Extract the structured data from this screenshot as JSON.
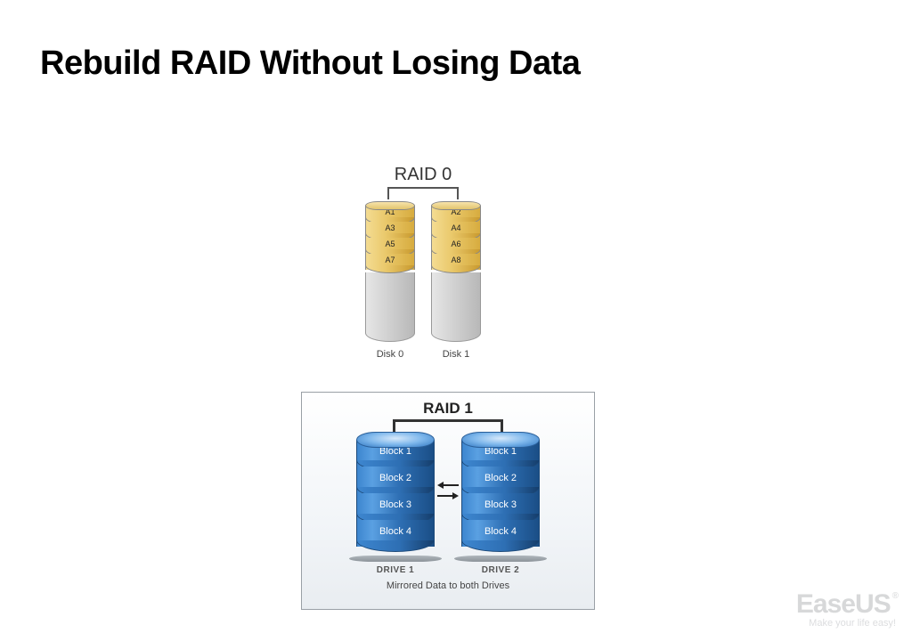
{
  "title": "Rebuild RAID Without Losing Data",
  "raid0": {
    "heading": "RAID 0",
    "disks": [
      {
        "label": "Disk 0",
        "blocks": [
          "A1",
          "A3",
          "A5",
          "A7"
        ]
      },
      {
        "label": "Disk 1",
        "blocks": [
          "A2",
          "A4",
          "A6",
          "A8"
        ]
      }
    ]
  },
  "raid1": {
    "heading": "RAID 1",
    "drives": [
      {
        "label": "DRIVE 1",
        "blocks": [
          "Block 1",
          "Block 2",
          "Block 3",
          "Block 4"
        ]
      },
      {
        "label": "DRIVE 2",
        "blocks": [
          "Block 1",
          "Block 2",
          "Block 3",
          "Block 4"
        ]
      }
    ],
    "caption": "Mirrored Data to both Drives"
  },
  "logo": {
    "brand": "EaseUS",
    "registered": "®",
    "tagline": "Make your life easy!"
  }
}
